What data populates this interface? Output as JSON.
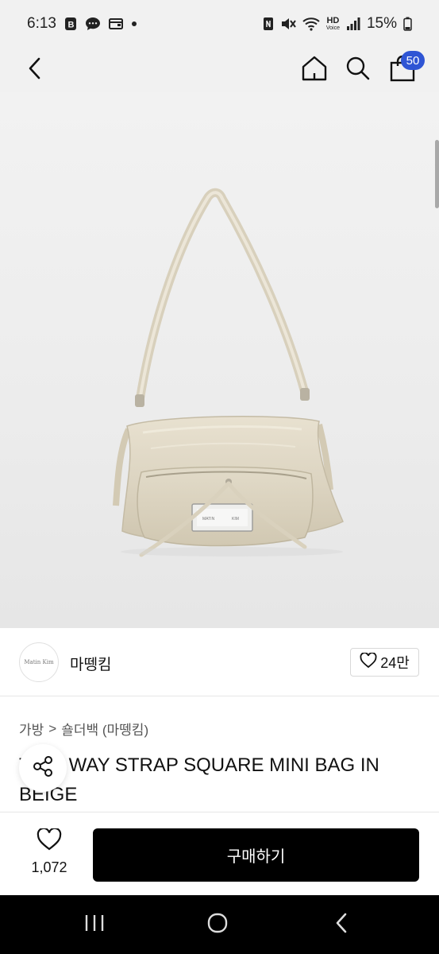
{
  "status_bar": {
    "time": "6:13",
    "notification_icons": [
      "b-app-icon",
      "message-icon",
      "wallet-icon",
      "dot-icon"
    ],
    "right_icons": [
      "nfc-icon",
      "mute-icon",
      "wifi-icon",
      "hd-voice-icon",
      "signal-icon"
    ],
    "hd_label": "HD",
    "voice_label": "Voice",
    "battery": "15%"
  },
  "header": {
    "cart_count": "50"
  },
  "product_image": {
    "plate_text_left": "MATIN",
    "plate_text_right": "KIM"
  },
  "seller": {
    "logo_text": "Matin Kim",
    "name": "마뗑킴",
    "likes": "24만"
  },
  "breadcrumb": {
    "category": "가방",
    "separator": ">",
    "subcategory": "숄더백 (마뗑킴)"
  },
  "product": {
    "title": "TWO WAY STRAP SQUARE MINI BAG IN BEIGE"
  },
  "bottom_bar": {
    "wish_count": "1,072",
    "buy_label": "구매하기"
  },
  "colors": {
    "badge": "#2f55d4",
    "buy_button": "#000000",
    "bag": "#ded6c3"
  }
}
